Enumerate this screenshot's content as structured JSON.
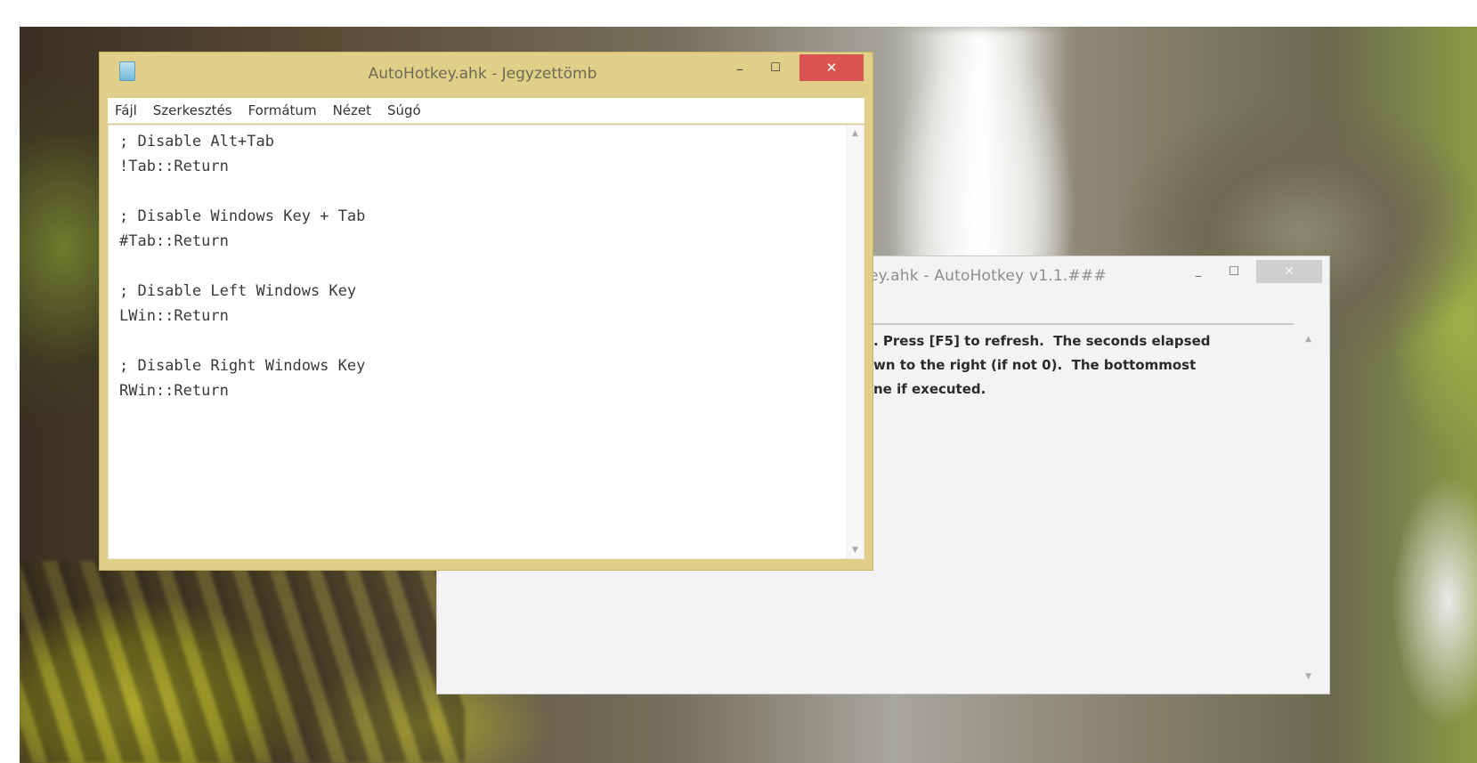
{
  "desktop": {
    "wallpaper": "waterfall-photo"
  },
  "notepad": {
    "title": "AutoHotkey.ahk - Jegyzettömb",
    "buttons": {
      "minimize": "–",
      "maximize": "◻",
      "close": "✕"
    },
    "menu": [
      "Fájl",
      "Szerkesztés",
      "Formátum",
      "Nézet",
      "Súgó"
    ],
    "lines": [
      "; Disable Alt+Tab",
      "!Tab::Return",
      "",
      "; Disable Windows Key + Tab",
      "#Tab::Return",
      "",
      "; Disable Left Windows Key",
      "LWin::Return",
      "",
      "; Disable Right Windows Key",
      "RWin::Return"
    ],
    "colors": {
      "frame": "#dfcf88",
      "close": "#d9534f"
    }
  },
  "ahk_window": {
    "title": "ey.ahk - AutoHotkey v1.1.###",
    "buttons": {
      "minimize": "–",
      "maximize": "◻",
      "close": "✕"
    },
    "content_lines": [
      ". Press [F5] to refresh.  The seconds elapsed",
      "wn to the right (if not 0).  The bottommost",
      "ne if executed."
    ]
  }
}
